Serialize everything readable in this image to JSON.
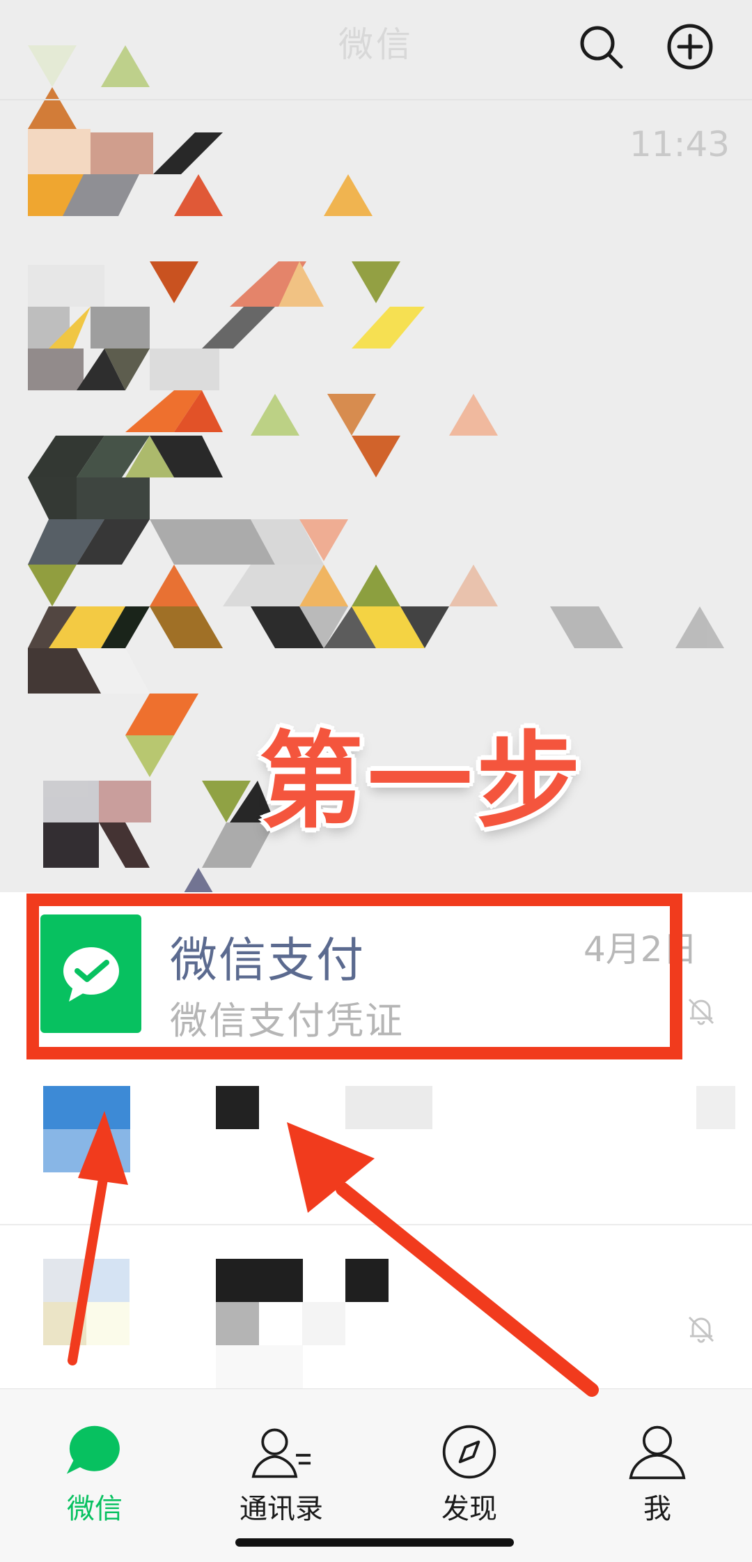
{
  "header": {
    "title": "微信"
  },
  "chat_list": {
    "top_chat_time": "11:43",
    "highlighted_chat": {
      "name": "微信支付",
      "preview": "微信支付凭证",
      "date": "4月2日",
      "muted_icon": "bell-slash-icon"
    }
  },
  "annotation": {
    "step_label": "第一步",
    "color": "#f13b1d"
  },
  "tabbar": {
    "tabs": [
      {
        "label": "微信",
        "icon": "chat-bubble-icon",
        "active": true
      },
      {
        "label": "通讯录",
        "icon": "contacts-icon",
        "active": false
      },
      {
        "label": "发现",
        "icon": "compass-icon",
        "active": false
      },
      {
        "label": "我",
        "icon": "person-icon",
        "active": false
      }
    ]
  },
  "colors": {
    "accent": "#07c160",
    "annotation_red": "#f13b1d",
    "name_text": "#5b6a8f"
  }
}
